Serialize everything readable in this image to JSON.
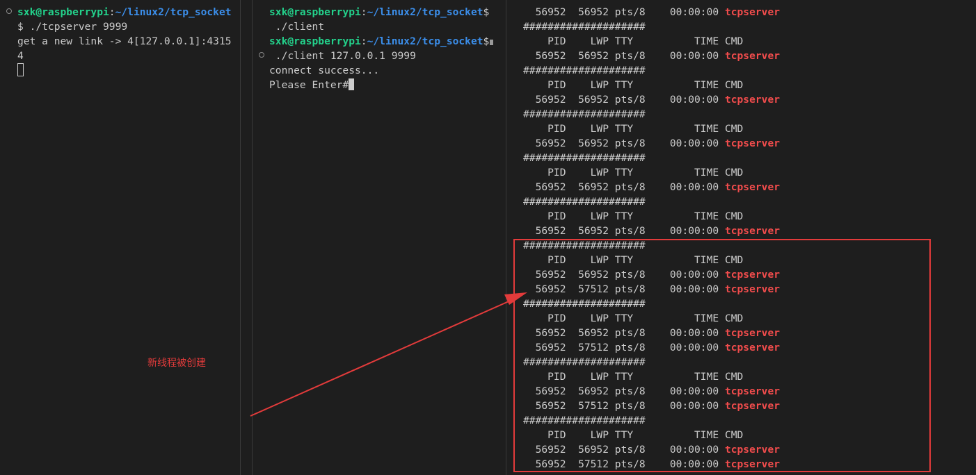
{
  "pane1": {
    "prompt": {
      "user": "sxk@raspberrypi",
      "colon": ":",
      "path": "~/linux2/tcp_socket"
    },
    "lines": [
      "$ ./tcpserver 9999",
      "get a new link -> 4[127.0.0.1]:4315",
      "4"
    ]
  },
  "pane2": {
    "prompt1": {
      "user": "sxk@raspberrypi",
      "colon": ":",
      "path": "~/linux2/tcp_socket",
      "tail": "$"
    },
    "cmd1": " ./client",
    "prompt2": {
      "user": "sxk@raspberrypi",
      "colon": ":",
      "path": "~/linux2/tcp_socket",
      "tail": "$"
    },
    "cmd2": " ./client 127.0.0.1 9999",
    "out1": "connect success...",
    "out2": "Please Enter#"
  },
  "pane3": {
    "separator": "####################",
    "header": "    PID    LWP TTY          TIME CMD",
    "rows": [
      {
        "kind": "row",
        "text": "  56952  56952 pts/8    00:00:00 ",
        "cmd": "tcpserver"
      },
      {
        "kind": "sep"
      },
      {
        "kind": "head"
      },
      {
        "kind": "row",
        "text": "  56952  56952 pts/8    00:00:00 ",
        "cmd": "tcpserver"
      },
      {
        "kind": "sep"
      },
      {
        "kind": "head"
      },
      {
        "kind": "row",
        "text": "  56952  56952 pts/8    00:00:00 ",
        "cmd": "tcpserver"
      },
      {
        "kind": "sep"
      },
      {
        "kind": "head"
      },
      {
        "kind": "row",
        "text": "  56952  56952 pts/8    00:00:00 ",
        "cmd": "tcpserver"
      },
      {
        "kind": "sep"
      },
      {
        "kind": "head"
      },
      {
        "kind": "row",
        "text": "  56952  56952 pts/8    00:00:00 ",
        "cmd": "tcpserver"
      },
      {
        "kind": "sep"
      },
      {
        "kind": "head"
      },
      {
        "kind": "row",
        "text": "  56952  56952 pts/8    00:00:00 ",
        "cmd": "tcpserver"
      },
      {
        "kind": "sep"
      },
      {
        "kind": "head"
      },
      {
        "kind": "row",
        "text": "  56952  56952 pts/8    00:00:00 ",
        "cmd": "tcpserver"
      },
      {
        "kind": "row",
        "text": "  56952  57512 pts/8    00:00:00 ",
        "cmd": "tcpserver"
      },
      {
        "kind": "sep"
      },
      {
        "kind": "head"
      },
      {
        "kind": "row",
        "text": "  56952  56952 pts/8    00:00:00 ",
        "cmd": "tcpserver"
      },
      {
        "kind": "row",
        "text": "  56952  57512 pts/8    00:00:00 ",
        "cmd": "tcpserver"
      },
      {
        "kind": "sep"
      },
      {
        "kind": "head"
      },
      {
        "kind": "row",
        "text": "  56952  56952 pts/8    00:00:00 ",
        "cmd": "tcpserver"
      },
      {
        "kind": "row",
        "text": "  56952  57512 pts/8    00:00:00 ",
        "cmd": "tcpserver"
      },
      {
        "kind": "sep"
      },
      {
        "kind": "head"
      },
      {
        "kind": "row",
        "text": "  56952  56952 pts/8    00:00:00 ",
        "cmd": "tcpserver"
      },
      {
        "kind": "row",
        "text": "  56952  57512 pts/8    00:00:00 ",
        "cmd": "tcpserver"
      }
    ]
  },
  "annotation": {
    "text": "新线程被创建",
    "color": "#e33b3b"
  },
  "colors": {
    "background": "#1e1e1e",
    "user": "#23d18b",
    "path": "#3b8eea",
    "process": "#f14c4c",
    "highlight": "#e33b3b"
  }
}
